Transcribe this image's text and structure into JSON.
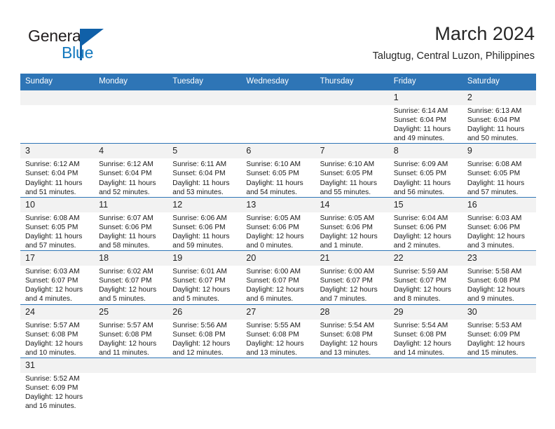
{
  "brand": {
    "name_top": "General",
    "name_bottom": "Blue",
    "color_dark": "#231f20",
    "color_blue": "#1278be",
    "triangle_color": "#1060a8"
  },
  "header": {
    "title": "March 2024",
    "subtitle": "Talugtug, Central Luzon, Philippines"
  },
  "theme": {
    "header_blue": "#2e75b6",
    "daynum_bg": "#f2f2f2",
    "text": "#1a1a1a"
  },
  "weekdays": [
    "Sunday",
    "Monday",
    "Tuesday",
    "Wednesday",
    "Thursday",
    "Friday",
    "Saturday"
  ],
  "labels": {
    "sunrise_prefix": "Sunrise:",
    "sunset_prefix": "Sunset:",
    "daylight_prefix": "Daylight:"
  },
  "weeks": [
    [
      {
        "day": "",
        "empty": true
      },
      {
        "day": "",
        "empty": true
      },
      {
        "day": "",
        "empty": true
      },
      {
        "day": "",
        "empty": true
      },
      {
        "day": "",
        "empty": true
      },
      {
        "day": "1",
        "sunrise": "Sunrise: 6:14 AM",
        "sunset": "Sunset: 6:04 PM",
        "daylight1": "Daylight: 11 hours",
        "daylight2": "and 49 minutes."
      },
      {
        "day": "2",
        "sunrise": "Sunrise: 6:13 AM",
        "sunset": "Sunset: 6:04 PM",
        "daylight1": "Daylight: 11 hours",
        "daylight2": "and 50 minutes."
      }
    ],
    [
      {
        "day": "3",
        "sunrise": "Sunrise: 6:12 AM",
        "sunset": "Sunset: 6:04 PM",
        "daylight1": "Daylight: 11 hours",
        "daylight2": "and 51 minutes."
      },
      {
        "day": "4",
        "sunrise": "Sunrise: 6:12 AM",
        "sunset": "Sunset: 6:04 PM",
        "daylight1": "Daylight: 11 hours",
        "daylight2": "and 52 minutes."
      },
      {
        "day": "5",
        "sunrise": "Sunrise: 6:11 AM",
        "sunset": "Sunset: 6:04 PM",
        "daylight1": "Daylight: 11 hours",
        "daylight2": "and 53 minutes."
      },
      {
        "day": "6",
        "sunrise": "Sunrise: 6:10 AM",
        "sunset": "Sunset: 6:05 PM",
        "daylight1": "Daylight: 11 hours",
        "daylight2": "and 54 minutes."
      },
      {
        "day": "7",
        "sunrise": "Sunrise: 6:10 AM",
        "sunset": "Sunset: 6:05 PM",
        "daylight1": "Daylight: 11 hours",
        "daylight2": "and 55 minutes."
      },
      {
        "day": "8",
        "sunrise": "Sunrise: 6:09 AM",
        "sunset": "Sunset: 6:05 PM",
        "daylight1": "Daylight: 11 hours",
        "daylight2": "and 56 minutes."
      },
      {
        "day": "9",
        "sunrise": "Sunrise: 6:08 AM",
        "sunset": "Sunset: 6:05 PM",
        "daylight1": "Daylight: 11 hours",
        "daylight2": "and 57 minutes."
      }
    ],
    [
      {
        "day": "10",
        "sunrise": "Sunrise: 6:08 AM",
        "sunset": "Sunset: 6:05 PM",
        "daylight1": "Daylight: 11 hours",
        "daylight2": "and 57 minutes."
      },
      {
        "day": "11",
        "sunrise": "Sunrise: 6:07 AM",
        "sunset": "Sunset: 6:06 PM",
        "daylight1": "Daylight: 11 hours",
        "daylight2": "and 58 minutes."
      },
      {
        "day": "12",
        "sunrise": "Sunrise: 6:06 AM",
        "sunset": "Sunset: 6:06 PM",
        "daylight1": "Daylight: 11 hours",
        "daylight2": "and 59 minutes."
      },
      {
        "day": "13",
        "sunrise": "Sunrise: 6:05 AM",
        "sunset": "Sunset: 6:06 PM",
        "daylight1": "Daylight: 12 hours",
        "daylight2": "and 0 minutes."
      },
      {
        "day": "14",
        "sunrise": "Sunrise: 6:05 AM",
        "sunset": "Sunset: 6:06 PM",
        "daylight1": "Daylight: 12 hours",
        "daylight2": "and 1 minute."
      },
      {
        "day": "15",
        "sunrise": "Sunrise: 6:04 AM",
        "sunset": "Sunset: 6:06 PM",
        "daylight1": "Daylight: 12 hours",
        "daylight2": "and 2 minutes."
      },
      {
        "day": "16",
        "sunrise": "Sunrise: 6:03 AM",
        "sunset": "Sunset: 6:06 PM",
        "daylight1": "Daylight: 12 hours",
        "daylight2": "and 3 minutes."
      }
    ],
    [
      {
        "day": "17",
        "sunrise": "Sunrise: 6:03 AM",
        "sunset": "Sunset: 6:07 PM",
        "daylight1": "Daylight: 12 hours",
        "daylight2": "and 4 minutes."
      },
      {
        "day": "18",
        "sunrise": "Sunrise: 6:02 AM",
        "sunset": "Sunset: 6:07 PM",
        "daylight1": "Daylight: 12 hours",
        "daylight2": "and 5 minutes."
      },
      {
        "day": "19",
        "sunrise": "Sunrise: 6:01 AM",
        "sunset": "Sunset: 6:07 PM",
        "daylight1": "Daylight: 12 hours",
        "daylight2": "and 5 minutes."
      },
      {
        "day": "20",
        "sunrise": "Sunrise: 6:00 AM",
        "sunset": "Sunset: 6:07 PM",
        "daylight1": "Daylight: 12 hours",
        "daylight2": "and 6 minutes."
      },
      {
        "day": "21",
        "sunrise": "Sunrise: 6:00 AM",
        "sunset": "Sunset: 6:07 PM",
        "daylight1": "Daylight: 12 hours",
        "daylight2": "and 7 minutes."
      },
      {
        "day": "22",
        "sunrise": "Sunrise: 5:59 AM",
        "sunset": "Sunset: 6:07 PM",
        "daylight1": "Daylight: 12 hours",
        "daylight2": "and 8 minutes."
      },
      {
        "day": "23",
        "sunrise": "Sunrise: 5:58 AM",
        "sunset": "Sunset: 6:08 PM",
        "daylight1": "Daylight: 12 hours",
        "daylight2": "and 9 minutes."
      }
    ],
    [
      {
        "day": "24",
        "sunrise": "Sunrise: 5:57 AM",
        "sunset": "Sunset: 6:08 PM",
        "daylight1": "Daylight: 12 hours",
        "daylight2": "and 10 minutes."
      },
      {
        "day": "25",
        "sunrise": "Sunrise: 5:57 AM",
        "sunset": "Sunset: 6:08 PM",
        "daylight1": "Daylight: 12 hours",
        "daylight2": "and 11 minutes."
      },
      {
        "day": "26",
        "sunrise": "Sunrise: 5:56 AM",
        "sunset": "Sunset: 6:08 PM",
        "daylight1": "Daylight: 12 hours",
        "daylight2": "and 12 minutes."
      },
      {
        "day": "27",
        "sunrise": "Sunrise: 5:55 AM",
        "sunset": "Sunset: 6:08 PM",
        "daylight1": "Daylight: 12 hours",
        "daylight2": "and 13 minutes."
      },
      {
        "day": "28",
        "sunrise": "Sunrise: 5:54 AM",
        "sunset": "Sunset: 6:08 PM",
        "daylight1": "Daylight: 12 hours",
        "daylight2": "and 13 minutes."
      },
      {
        "day": "29",
        "sunrise": "Sunrise: 5:54 AM",
        "sunset": "Sunset: 6:08 PM",
        "daylight1": "Daylight: 12 hours",
        "daylight2": "and 14 minutes."
      },
      {
        "day": "30",
        "sunrise": "Sunrise: 5:53 AM",
        "sunset": "Sunset: 6:09 PM",
        "daylight1": "Daylight: 12 hours",
        "daylight2": "and 15 minutes."
      }
    ],
    [
      {
        "day": "31",
        "sunrise": "Sunrise: 5:52 AM",
        "sunset": "Sunset: 6:09 PM",
        "daylight1": "Daylight: 12 hours",
        "daylight2": "and 16 minutes."
      },
      {
        "day": "",
        "empty": true
      },
      {
        "day": "",
        "empty": true
      },
      {
        "day": "",
        "empty": true
      },
      {
        "day": "",
        "empty": true
      },
      {
        "day": "",
        "empty": true
      },
      {
        "day": "",
        "empty": true
      }
    ]
  ]
}
